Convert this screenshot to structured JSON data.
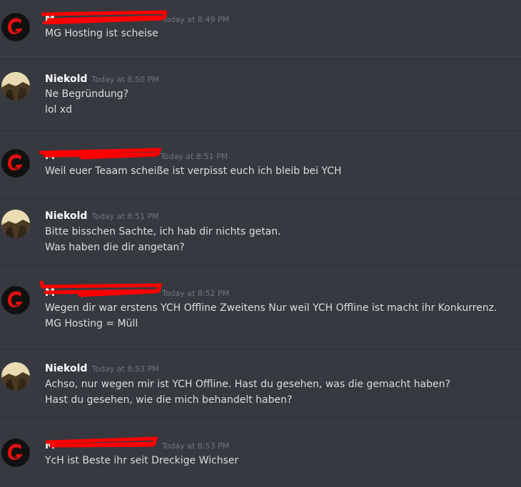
{
  "messages": [
    {
      "author": "M",
      "timestamp": "Today at 8:49 PM",
      "lines": [
        "MG Hosting ist scheise"
      ]
    },
    {
      "author": "Niekold",
      "timestamp": "Today at 8:50 PM",
      "lines": [
        "Ne Begründung?",
        "lol xd"
      ]
    },
    {
      "author": "M",
      "timestamp": "Today at 8:51 PM",
      "lines": [
        "Weil euer Teaam scheiße ist verpisst euch ich bleib bei YCH"
      ]
    },
    {
      "author": "Niekold",
      "timestamp": "Today at 8:51 PM",
      "lines": [
        "Bitte bisschen Sachte, ich hab dir nichts getan.",
        "Was haben die dir angetan?"
      ]
    },
    {
      "author": "M",
      "timestamp": "Today at 8:52 PM",
      "lines": [
        "Wegen dir war erstens YCH Offline Zweitens  Nur weil YCH Offline ist macht ihr Konkurrenz.",
        "MG Hosting = Müll"
      ]
    },
    {
      "author": "Niekold",
      "timestamp": "Today at 8:53 PM",
      "lines": [
        "Achso, nur wegen mir ist YCH Offline. Hast du gesehen, was die gemacht haben?",
        "Hast du gesehen, wie die mich behandelt haben?"
      ]
    },
    {
      "author": "M",
      "timestamp": "Today at 8:53 PM",
      "lines": [
        "YcH ist Beste ihr seit Dreckige Wichser"
      ]
    }
  ],
  "colors": {
    "background": "#36393f",
    "divider": "#40444b",
    "username": "#ffffff",
    "timestamp": "#72767d",
    "text": "#dcddde",
    "redaction": "#ff0000",
    "mg_avatar_bg": "#111111",
    "mg_avatar_logo": "#e01010"
  },
  "avatars": {
    "M": "red-g-logo-icon",
    "Niekold": "landscape-photo-avatar"
  }
}
